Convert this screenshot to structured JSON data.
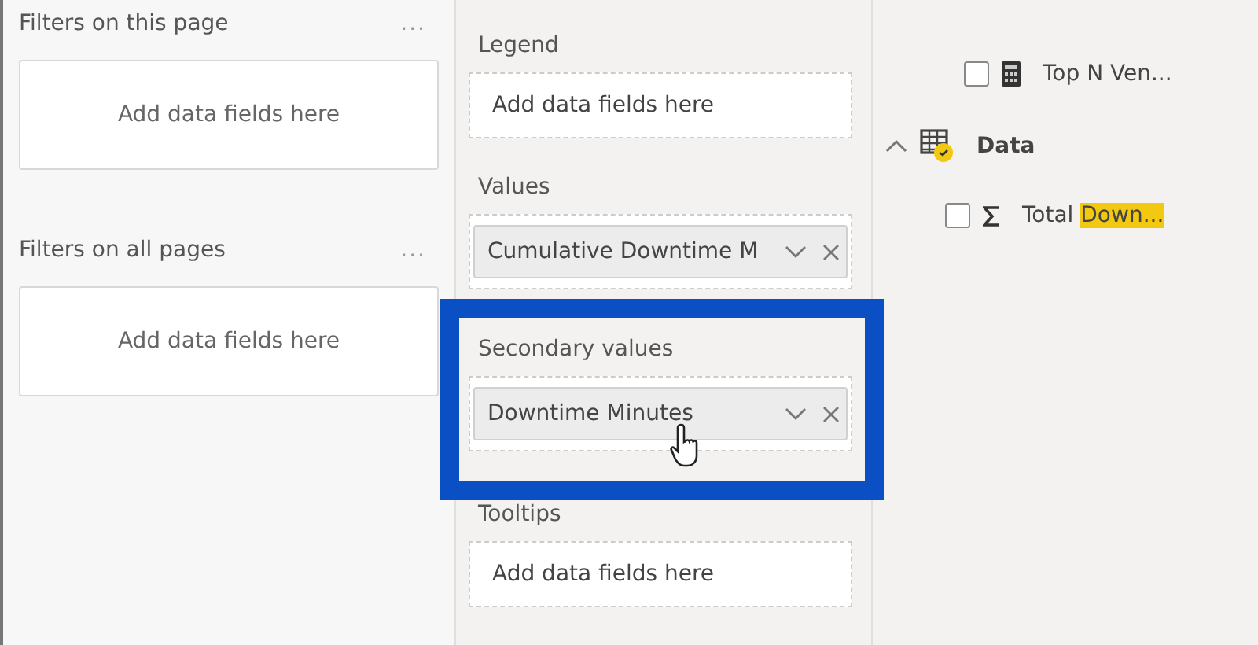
{
  "filters_pane": {
    "sections": [
      {
        "title": "Filters on this page",
        "more": "...",
        "placeholder": "Add data fields here"
      },
      {
        "title": "Filters on all pages",
        "more": "...",
        "placeholder": "Add data fields here"
      }
    ]
  },
  "visualizations_pane": {
    "wells": [
      {
        "label": "Legend",
        "placeholder": "Add data fields here"
      },
      {
        "label": "Values",
        "field": "Cumulative Downtime M"
      },
      {
        "label": "Secondary values",
        "highlighted": true,
        "field": "Downtime Minutes",
        "hovered": true
      },
      {
        "label": "Tooltips",
        "placeholder": "Add data fields here"
      }
    ]
  },
  "fields_pane": {
    "items": [
      {
        "kind": "measure",
        "label": "Top N Ven...",
        "checked": false
      },
      {
        "kind": "table",
        "label": "Data",
        "expanded": true,
        "children": [
          {
            "kind": "sum",
            "label": "Total ",
            "match": "Down...",
            "checked": false
          }
        ]
      }
    ]
  }
}
